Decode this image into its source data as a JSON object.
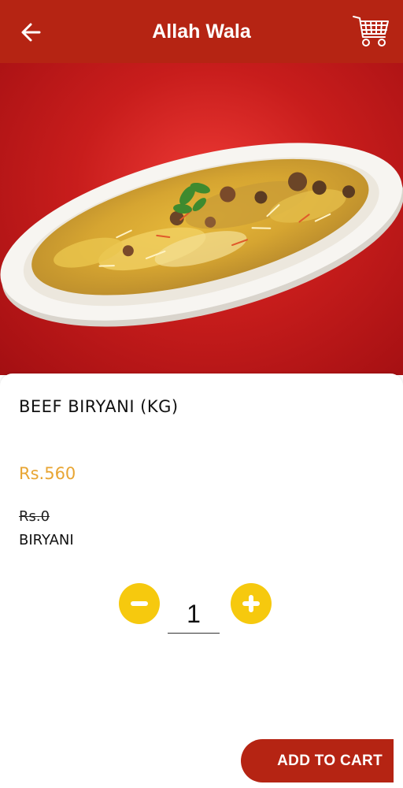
{
  "app_bar": {
    "title": "Allah Wala",
    "back_icon": "arrow-left-icon",
    "cart_icon": "shopping-cart-icon",
    "background_color": "#b52413"
  },
  "hero_image": {
    "subject": "plate of biryani",
    "background_color": "#c81d1c"
  },
  "product": {
    "name": "BEEF BIRYANI (KG)",
    "price": "Rs.560",
    "original_price": "Rs.0",
    "category": "BIRYANI",
    "price_color": "#e8a533"
  },
  "quantity": {
    "value": "1",
    "decrement_icon": "minus-icon",
    "increment_icon": "plus-icon",
    "button_color": "#f6c90e"
  },
  "actions": {
    "add_to_cart_label": "ADD TO CART",
    "button_color": "#b52413"
  }
}
